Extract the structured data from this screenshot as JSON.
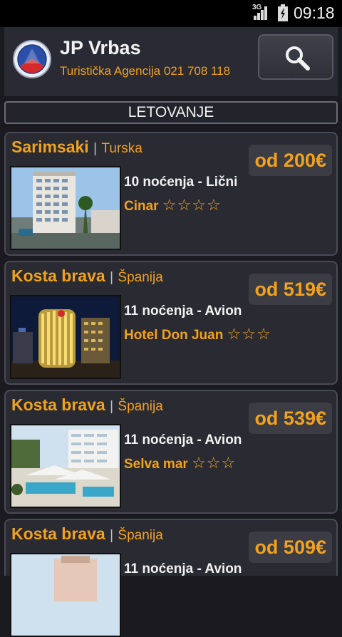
{
  "status_bar": {
    "network": "3G",
    "time": "09:18"
  },
  "header": {
    "title": "JP Vrbas",
    "subtitle": "Turistička Agencija 021 708 118",
    "logo_icon": "agency-logo",
    "search_icon": "search-icon"
  },
  "category": {
    "label": "LETOVANJE"
  },
  "offers": [
    {
      "destination": "Sarimsaki",
      "separator": "|",
      "country": "Turska",
      "price": "od 200€",
      "nights_transport": "10 noćenja - Lični",
      "hotel": "Cinar",
      "stars": "☆☆☆☆"
    },
    {
      "destination": "Kosta brava",
      "separator": "|",
      "country": "Španija",
      "price": "od 519€",
      "nights_transport": "11 noćenja - Avion",
      "hotel": "Hotel Don Juan",
      "stars": "☆☆☆"
    },
    {
      "destination": "Kosta brava",
      "separator": "|",
      "country": "Španija",
      "price": "od 539€",
      "nights_transport": "11 noćenja - Avion",
      "hotel": "Selva mar",
      "stars": "☆☆☆"
    },
    {
      "destination": "Kosta brava",
      "separator": "|",
      "country": "Španija",
      "price": "od 509€",
      "nights_transport": "11 noćenja - Avion",
      "hotel": "",
      "stars": ""
    }
  ],
  "colors": {
    "accent": "#f2a21b",
    "background": "#1b1a20",
    "card": "#2a2a33"
  }
}
